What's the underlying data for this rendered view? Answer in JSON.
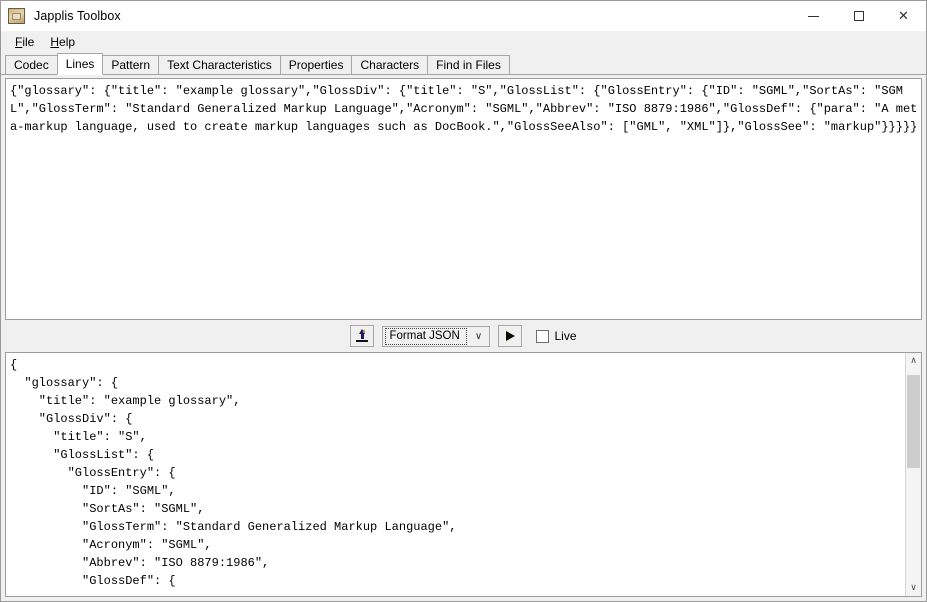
{
  "window": {
    "title": "Japplis Toolbox",
    "icon": "toolbox-icon",
    "controls": {
      "minimize": "minimize-icon",
      "maximize": "maximize-icon",
      "close": "close-icon",
      "close_glyph": "✕"
    }
  },
  "menubar": {
    "items": [
      {
        "label": "File",
        "mnemonic": "F",
        "rest": "ile"
      },
      {
        "label": "Help",
        "mnemonic": "H",
        "rest": "elp"
      }
    ]
  },
  "tabs": {
    "selected": "Lines",
    "items": [
      {
        "label": "Codec",
        "selected": false
      },
      {
        "label": "Lines",
        "selected": true
      },
      {
        "label": "Pattern",
        "selected": false
      },
      {
        "label": "Text Characteristics",
        "selected": false
      },
      {
        "label": "Properties",
        "selected": false
      },
      {
        "label": "Characters",
        "selected": false
      },
      {
        "label": "Find in Files",
        "selected": false
      }
    ]
  },
  "input_panel": {
    "name": "input-text-area",
    "text": "{\"glossary\": {\"title\": \"example glossary\",\"GlossDiv\": {\"title\": \"S\",\"GlossList\": {\"GlossEntry\": {\"ID\": \"SGML\",\"SortAs\": \"SGML\",\"GlossTerm\": \"Standard Generalized Markup Language\",\"Acronym\": \"SGML\",\"Abbrev\": \"ISO 8879:1986\",\"GlossDef\": {\"para\": \"A meta-markup language, used to create markup languages such as DocBook.\",\"GlossSeeAlso\": [\"GML\", \"XML\"]},\"GlossSee\": \"markup\"}}}}}"
  },
  "toolbar": {
    "export_button": {
      "name": "export-button",
      "icon": "upload-arrow-icon"
    },
    "action_select": {
      "name": "action-select",
      "value": "Format JSON",
      "arrow": "∨",
      "options": [
        "Format JSON"
      ]
    },
    "run_button": {
      "name": "run-button",
      "icon": "play-icon"
    },
    "live_checkbox": {
      "name": "live-checkbox",
      "label": "Live",
      "checked": false
    }
  },
  "output_panel": {
    "name": "output-text-area",
    "text": "{\n  \"glossary\": {\n    \"title\": \"example glossary\",\n    \"GlossDiv\": {\n      \"title\": \"S\",\n      \"GlossList\": {\n        \"GlossEntry\": {\n          \"ID\": \"SGML\",\n          \"SortAs\": \"SGML\",\n          \"GlossTerm\": \"Standard Generalized Markup Language\",\n          \"Acronym\": \"SGML\",\n          \"Abbrev\": \"ISO 8879:1986\",\n          \"GlossDef\": {"
  },
  "scrollbar": {
    "up_arrow": "∧",
    "down_arrow": "∨",
    "thumb_name": "scrollbar-thumb"
  },
  "colors": {
    "window_bg": "#f0f0f0",
    "panel_bg": "#ffffff",
    "border": "#9d9d9d",
    "text": "#000000",
    "scroll_thumb": "#cdcdcd"
  }
}
